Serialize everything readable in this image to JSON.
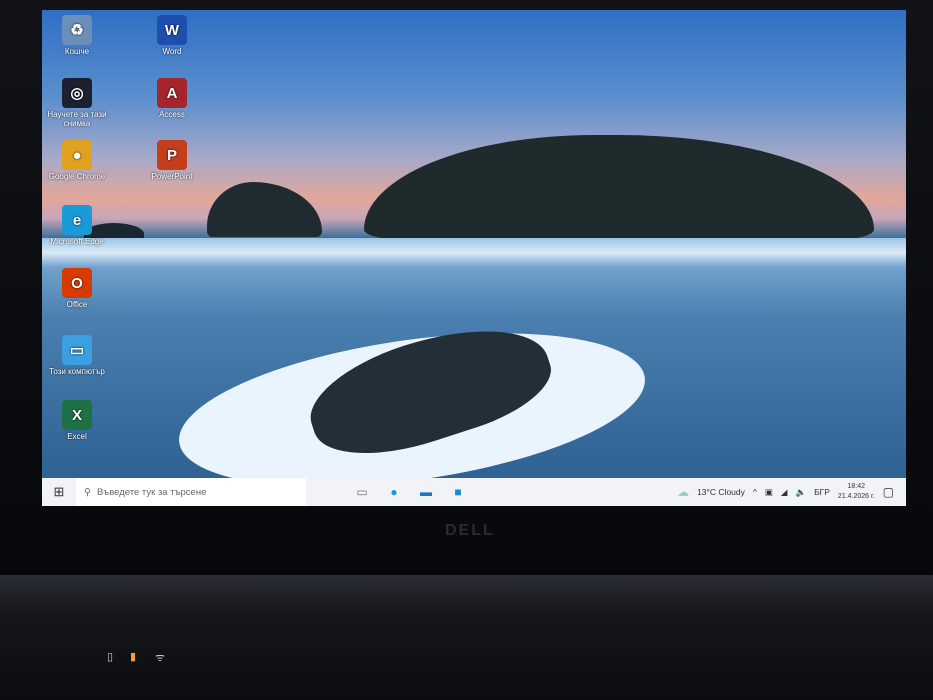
{
  "desktop_icons": [
    {
      "label": "Кошче",
      "glyph": "♻",
      "color": "#6b8fb8"
    },
    {
      "label": "Word",
      "glyph": "W",
      "color": "#1f4fae"
    },
    {
      "label": "Научете за тази снимка",
      "glyph": "◎",
      "color": "#1c2030"
    },
    {
      "label": "Access",
      "glyph": "A",
      "color": "#a4262c"
    },
    {
      "label": "Google Chrome",
      "glyph": "●",
      "color": "#e0a020"
    },
    {
      "label": "PowerPoint",
      "glyph": "P",
      "color": "#c43e1c"
    },
    {
      "label": "Microsoft Edge",
      "glyph": "e",
      "color": "#1a9ad6"
    },
    {
      "label": "Office",
      "glyph": "O",
      "color": "#d83b01"
    },
    {
      "label": "Този компютър",
      "glyph": "▭",
      "color": "#3aa0e0"
    },
    {
      "label": "Excel",
      "glyph": "X",
      "color": "#1e7145"
    }
  ],
  "taskbar": {
    "start_icon": "windows-icon",
    "search_placeholder": "Въведете тук за търсене",
    "weather": "13°C  Cloudy",
    "language": "БГР",
    "time": "18:42",
    "date": "21.4.2026 г."
  },
  "brand": "DELL"
}
